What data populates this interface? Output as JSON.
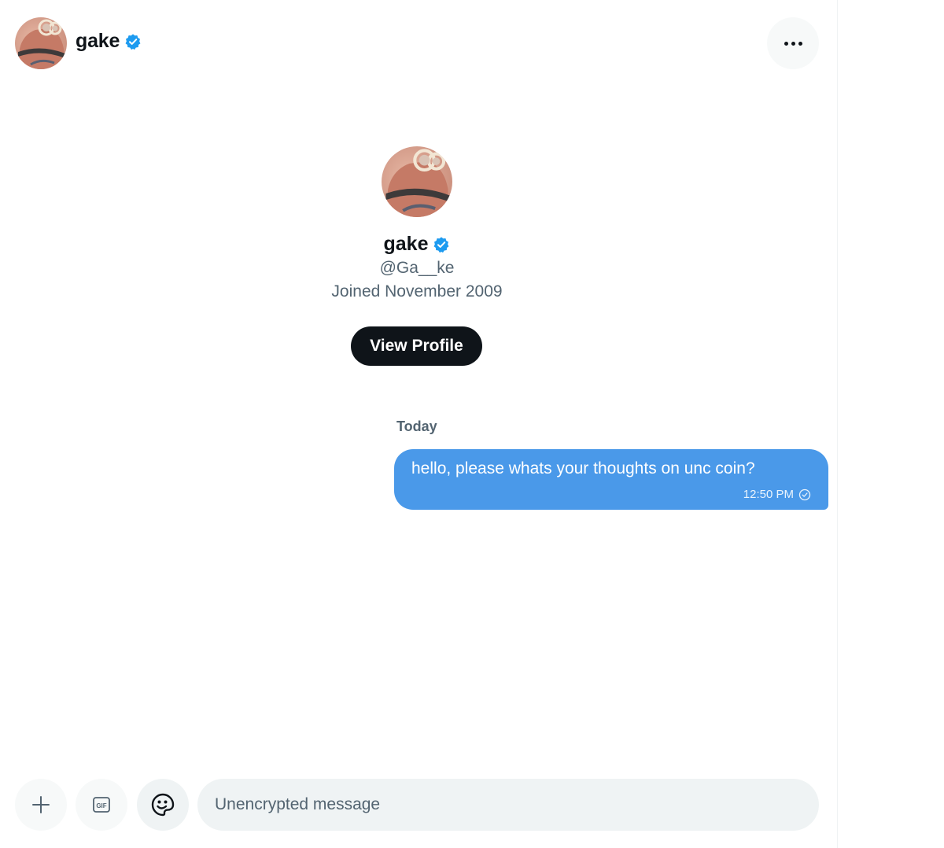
{
  "header": {
    "name": "gake",
    "avatar_icon": "minion-avatar",
    "verified_icon": "verified-badge-icon",
    "more_icon": "more-options-icon"
  },
  "profile": {
    "name": "gake",
    "handle": "@Ga__ke",
    "joined": "Joined November 2009",
    "view_profile_label": "View Profile"
  },
  "messages": {
    "day_label": "Today",
    "items": [
      {
        "text": "hello, please whats your thoughts on unc coin?",
        "time": "12:50 PM",
        "status_icon": "sent-check-icon",
        "direction": "outgoing"
      }
    ]
  },
  "composer": {
    "placeholder": "Unencrypted message",
    "add_icon": "plus-icon",
    "gif_label": "GIF",
    "emoji_icon": "emoji-icon"
  },
  "colors": {
    "accent": "#1d9bf0",
    "bubble": "#4a99e9",
    "text": "#0f1419",
    "secondary": "#536471",
    "button_dark": "#0f1419"
  }
}
